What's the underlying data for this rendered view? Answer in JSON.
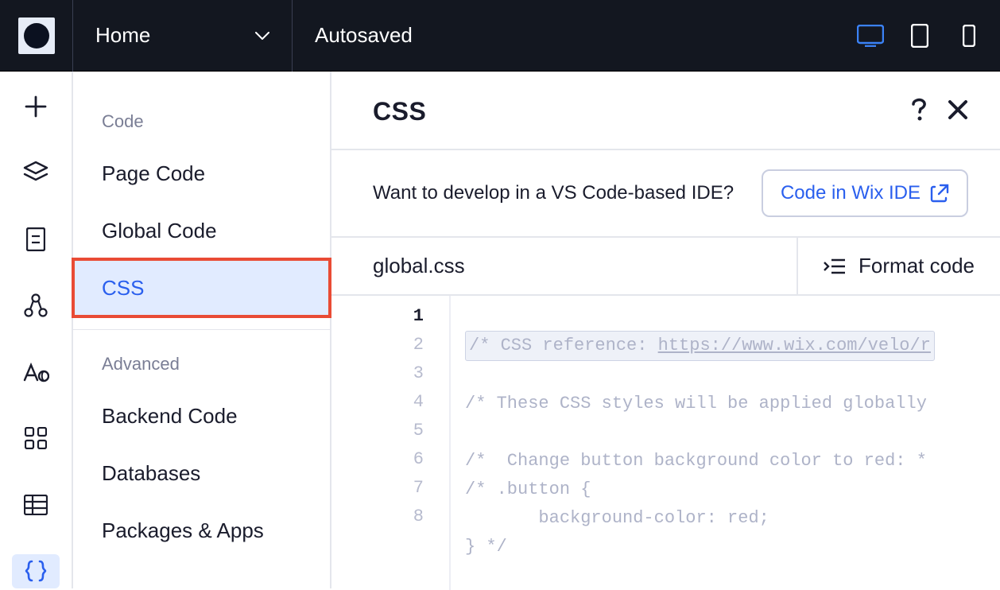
{
  "topbar": {
    "page_label": "Home",
    "status": "Autosaved"
  },
  "sidebar": {
    "section_code": "Code",
    "section_advanced": "Advanced",
    "items": {
      "page_code": "Page Code",
      "global_code": "Global Code",
      "css": "CSS",
      "backend_code": "Backend Code",
      "databases": "Databases",
      "packages_apps": "Packages & Apps"
    }
  },
  "editor": {
    "title": "CSS",
    "banner_text": "Want to develop in a VS Code-based IDE?",
    "cta_label": "Code in Wix IDE",
    "file_tab": "global.css",
    "format_label": "Format code"
  },
  "code": {
    "lines": {
      "l1": "/* CSS reference: https://www.wix.com/velo/r",
      "l2": "",
      "l3": "/* These CSS styles will be applied globally",
      "l4": "",
      "l5": "/*  Change button background color to red: *",
      "l6": "/* .button {",
      "l7": "       background-color: red;",
      "l8": "} */"
    }
  }
}
